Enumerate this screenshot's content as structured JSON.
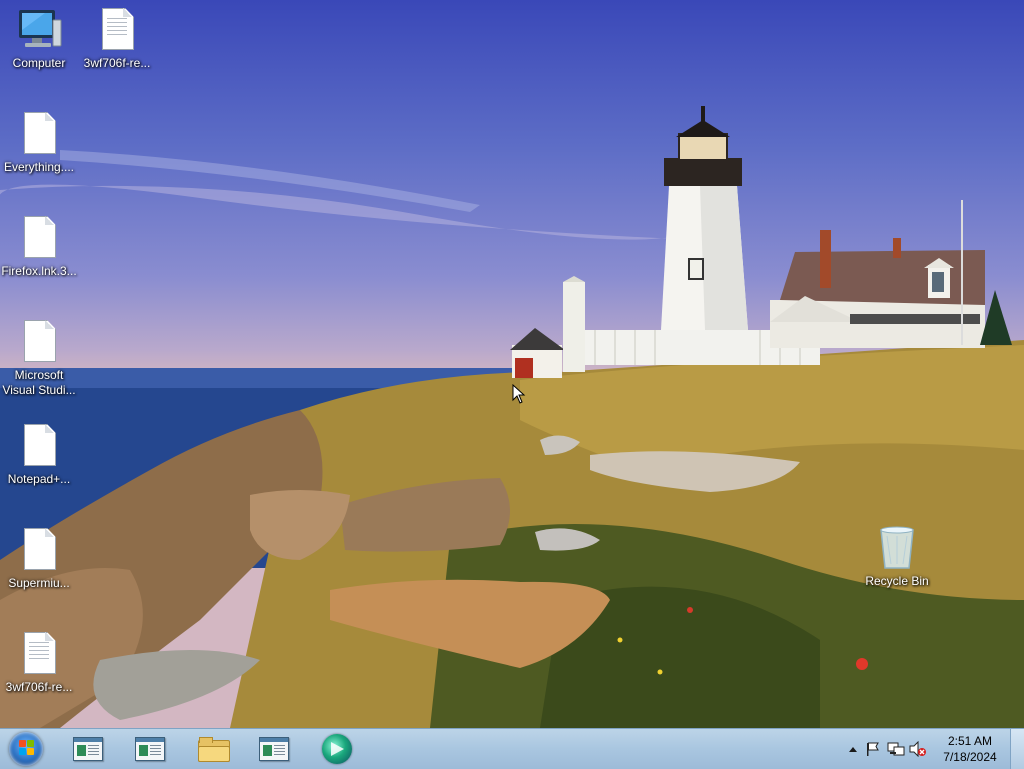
{
  "desktop": {
    "icons": [
      {
        "label": "Computer",
        "icon": "computer-icon"
      },
      {
        "label": "3wf706f-re...",
        "icon": "file-icon"
      },
      {
        "label": "Everything....",
        "icon": "file-icon"
      },
      {
        "label": "Firefox.lnk.3...",
        "icon": "file-icon"
      },
      {
        "label": "Microsoft Visual Studi...",
        "icon": "file-icon"
      },
      {
        "label": "Notepad+...",
        "icon": "file-icon"
      },
      {
        "label": "Supermiu...",
        "icon": "file-icon"
      },
      {
        "label": "3wf706f-re...",
        "icon": "file-icon"
      },
      {
        "label": "Recycle Bin",
        "icon": "recycle-bin-icon"
      }
    ]
  },
  "taskbar": {
    "start_icon": "windows-orb-icon",
    "pinned": [
      {
        "icon": "window-app-icon"
      },
      {
        "icon": "window-app-icon"
      },
      {
        "icon": "folder-icon"
      },
      {
        "icon": "window-app-icon"
      },
      {
        "icon": "media-app-icon"
      }
    ],
    "tray": {
      "icons": [
        "show-hidden-icons-arrow",
        "action-center-flag-icon",
        "network-icon",
        "volume-muted-icon"
      ],
      "time": "2:51 AM",
      "date": "7/18/2024"
    }
  }
}
